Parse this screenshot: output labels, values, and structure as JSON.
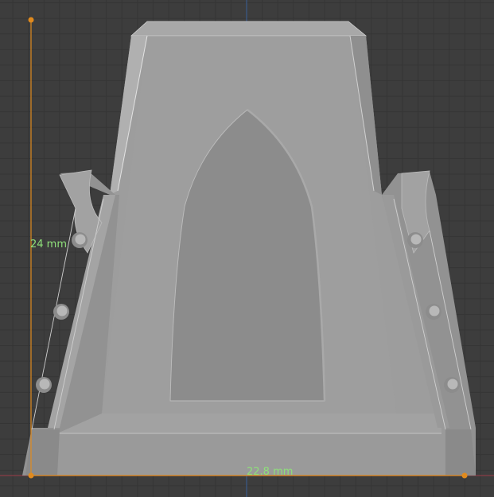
{
  "viewport": {
    "background_color": "#3d3d3d",
    "grid_color": "#353535",
    "x_axis_color": "#8a3c45",
    "y_axis_color": "#3a5a8a"
  },
  "model": {
    "face_color": "#9d9d9d",
    "side_color": "#8a8a8a",
    "recess_color": "#8c8c8c",
    "edge_highlight": "#dcdcdc"
  },
  "measurements": {
    "color": "#e08a1e",
    "label_color": "#8ee07a",
    "height": {
      "label": "24 mm"
    },
    "width": {
      "label": "22.8 mm"
    }
  }
}
